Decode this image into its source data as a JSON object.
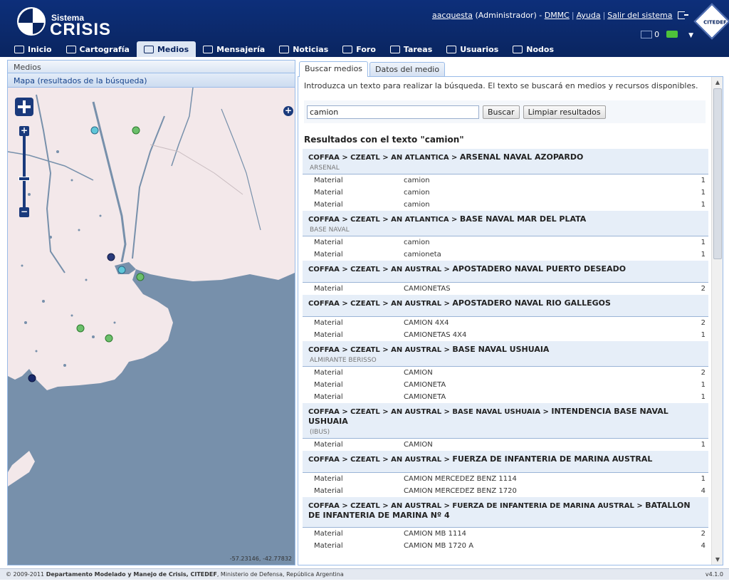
{
  "header": {
    "logo_small": "Sistema",
    "logo_big": "CRISIS",
    "user_name": "aacquesta",
    "user_role": "(Administrador) -",
    "org": "DMMC",
    "help": "Ayuda",
    "logout": "Salir del sistema",
    "mail_count": "0",
    "org_badge": "CITEDEF"
  },
  "nav": [
    {
      "label": "Inicio"
    },
    {
      "label": "Cartografía"
    },
    {
      "label": "Medios"
    },
    {
      "label": "Mensajería"
    },
    {
      "label": "Noticias"
    },
    {
      "label": "Foro"
    },
    {
      "label": "Tareas"
    },
    {
      "label": "Usuarios"
    },
    {
      "label": "Nodos"
    }
  ],
  "left_panel": {
    "title": "Medios",
    "map_title": "Mapa (resultados de la búsqueda)",
    "coords": "-57.23146, -42.77832"
  },
  "tabs": [
    {
      "label": "Buscar medios"
    },
    {
      "label": "Datos del medio"
    }
  ],
  "search": {
    "intro": "Introduzca un texto para realizar la búsqueda. El texto se buscará en medios y recursos disponibles.",
    "value": "camion",
    "search_button": "Buscar",
    "clear_button": "Limpiar resultados",
    "results_heading": "Resultados con el texto \"camion\""
  },
  "results": [
    {
      "path": "COFFAA > CZEATL > AN ATLANTICA > ",
      "leaf": "ARSENAL NAVAL AZOPARDO",
      "sub": "ARSENAL",
      "rows": [
        [
          "Material",
          "camion",
          "1"
        ],
        [
          "Material",
          "camion",
          "1"
        ],
        [
          "Material",
          "camion",
          "1"
        ]
      ]
    },
    {
      "path": "COFFAA > CZEATL > AN ATLANTICA > ",
      "leaf": "BASE NAVAL MAR DEL PLATA",
      "sub": "BASE NAVAL",
      "rows": [
        [
          "Material",
          "camion",
          "1"
        ],
        [
          "Material",
          "camioneta",
          "1"
        ]
      ]
    },
    {
      "path": "COFFAA > CZEATL > AN AUSTRAL > ",
      "leaf": "APOSTADERO NAVAL PUERTO DESEADO",
      "sub": "",
      "rows": [
        [
          "Material",
          "CAMIONETAS",
          "2"
        ]
      ]
    },
    {
      "path": "COFFAA > CZEATL > AN AUSTRAL > ",
      "leaf": "APOSTADERO NAVAL RIO GALLEGOS",
      "sub": "",
      "rows": [
        [
          "Material",
          "CAMION 4X4",
          "2"
        ],
        [
          "Material",
          "CAMIONETAS 4X4",
          "1"
        ]
      ]
    },
    {
      "path": "COFFAA > CZEATL > AN AUSTRAL > ",
      "leaf": "BASE NAVAL USHUAIA",
      "sub": "ALMIRANTE BERISSO",
      "rows": [
        [
          "Material",
          "CAMION",
          "2"
        ],
        [
          "Material",
          "CAMIONETA",
          "1"
        ],
        [
          "Material",
          "CAMIONETA",
          "1"
        ]
      ]
    },
    {
      "path": "COFFAA > CZEATL > AN AUSTRAL > BASE NAVAL USHUAIA > ",
      "leaf": "INTENDENCIA BASE NAVAL USHUAIA",
      "sub": "(IBUS)",
      "rows": [
        [
          "Material",
          "CAMION",
          "1"
        ]
      ]
    },
    {
      "path": "COFFAA > CZEATL > AN AUSTRAL > ",
      "leaf": "FUERZA DE INFANTERIA DE MARINA AUSTRAL",
      "sub": "",
      "rows": [
        [
          "Material",
          "CAMION MERCEDEZ BENZ 1114",
          "1"
        ],
        [
          "Material",
          "CAMION MERCEDEZ BENZ 1720",
          "4"
        ]
      ]
    },
    {
      "path": "COFFAA > CZEATL > AN AUSTRAL > FUERZA DE INFANTERIA DE MARINA AUSTRAL > ",
      "leaf": "BATALLON DE INFANTERIA DE MARINA Nº 4",
      "sub": "",
      "rows": [
        [
          "Material",
          "CAMION MB 1114",
          "2"
        ],
        [
          "Material",
          "CAMION MB 1720 A",
          "4"
        ]
      ]
    }
  ],
  "footer": {
    "prefix": "© 2009-2011 ",
    "dept": "Departamento Modelado y Manejo de Crisis, CITEDEF",
    "suffix": ", Ministerio de Defensa, República Argentina",
    "version": "v4.1.0"
  },
  "colors": {
    "header": "#0a2560",
    "accent": "#99bbe8",
    "land": "#f3e8ea",
    "water": "#7790ab"
  }
}
